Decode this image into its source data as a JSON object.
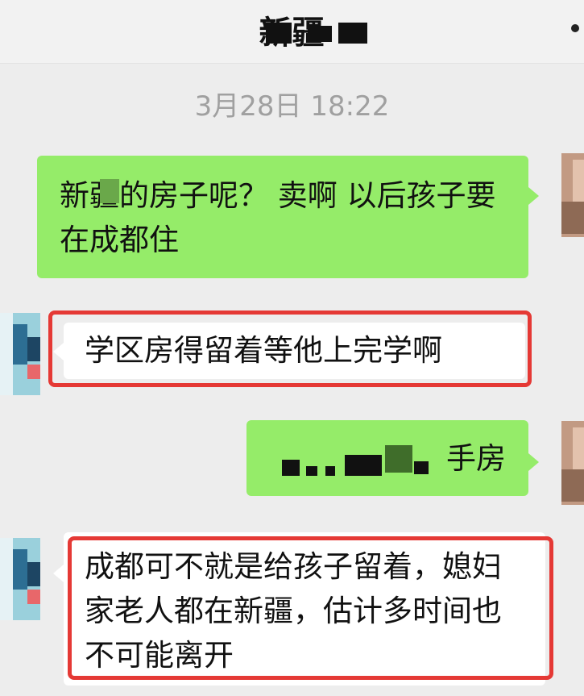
{
  "header": {
    "title": "新疆"
  },
  "timestamp": "3月28日 18:22",
  "messages": [
    {
      "from": "me",
      "text": "新疆的房子呢？ 卖啊 以后孩子要在成都住"
    },
    {
      "from": "other",
      "text": "学区房得留着等他上完学啊"
    },
    {
      "from": "me",
      "text": "手房"
    },
    {
      "from": "other",
      "text": "成都可不就是给孩子留着，媳妇家老人都在新疆，估计多时间也不可能离开"
    }
  ],
  "colors": {
    "my_bubble": "#95ec69",
    "their_bubble": "#ffffff",
    "highlight": "#e53935",
    "background": "#ededed"
  }
}
